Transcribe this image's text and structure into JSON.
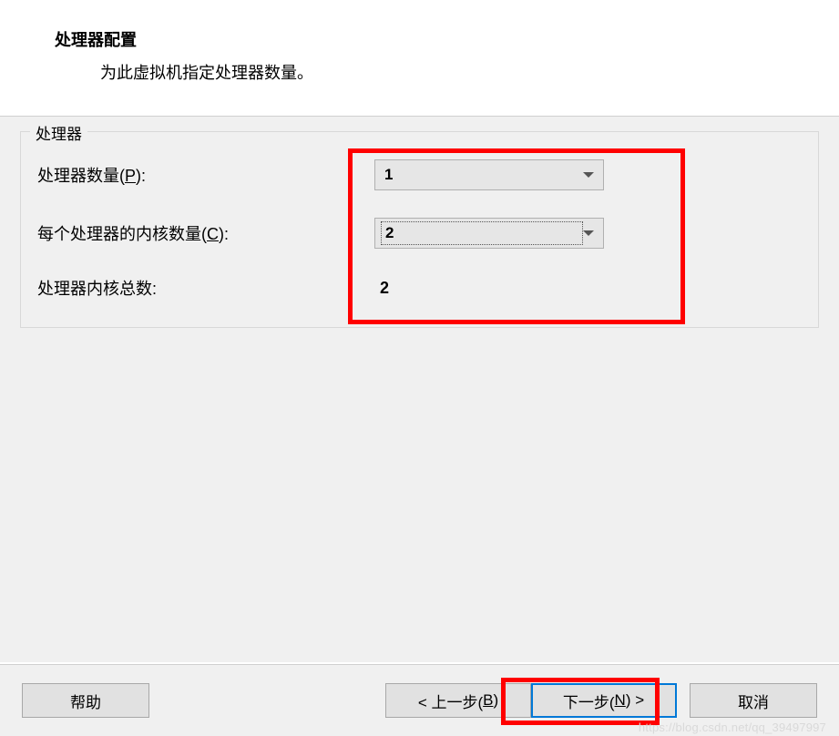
{
  "header": {
    "title": "处理器配置",
    "subtitle": "为此虚拟机指定处理器数量。"
  },
  "fieldset": {
    "legend": "处理器",
    "rows": {
      "processor_count": {
        "label_prefix": "处理器数量(",
        "accelerator": "P",
        "label_suffix": "):",
        "value": "1"
      },
      "cores_per_processor": {
        "label_prefix": "每个处理器的内核数量(",
        "accelerator": "C",
        "label_suffix": "):",
        "value": "2"
      },
      "total_cores": {
        "label": "处理器内核总数:",
        "value": "2"
      }
    }
  },
  "footer": {
    "help": "帮助",
    "back_prefix": "< 上一步(",
    "back_accelerator": "B",
    "back_suffix": ")",
    "next_prefix": "下一步(",
    "next_accelerator": "N",
    "next_suffix": ") >",
    "cancel": "取消"
  },
  "watermark": "https://blog.csdn.net/qq_39497997"
}
